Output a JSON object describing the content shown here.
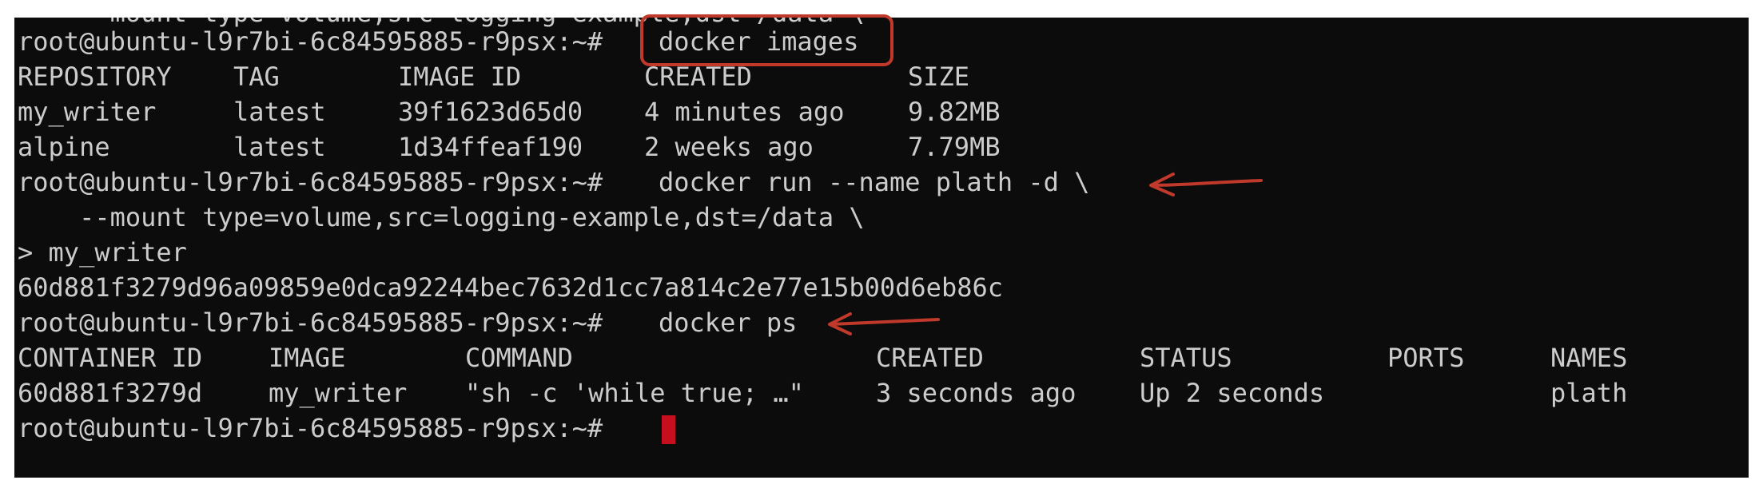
{
  "terminal": {
    "partial_top_line": "    --mount type=volume,src=logging-example,dst=/data \\",
    "prompt": "root@ubuntu-l9r7bi-6c84595885-r9psx:~#",
    "commands": {
      "images": "docker images",
      "run_line1": "docker run --name plath -d \\",
      "run_line2": "    --mount type=volume,src=logging-example,dst=/data \\",
      "run_line3": "> my_writer",
      "ps": "docker ps"
    },
    "images_table": {
      "headers": [
        "REPOSITORY",
        "TAG",
        "IMAGE ID",
        "CREATED",
        "SIZE"
      ],
      "rows": [
        [
          "my_writer",
          "latest",
          "39f1623d65d0",
          "4 minutes ago",
          "9.82MB"
        ],
        [
          "alpine",
          "latest",
          "1d34ffeaf190",
          "2 weeks ago",
          "7.79MB"
        ]
      ]
    },
    "container_hash": "60d881f3279d96a09859e0dca92244bec7632d1cc7a814c2e77e15b00d6eb86c",
    "ps_table": {
      "headers": [
        "CONTAINER ID",
        "IMAGE",
        "COMMAND",
        "CREATED",
        "STATUS",
        "PORTS",
        "NAMES"
      ],
      "rows": [
        [
          "60d881f3279d",
          "my_writer",
          "\"sh -c 'while true; …\"",
          "3 seconds ago",
          "Up 2 seconds",
          "",
          "plath"
        ]
      ]
    }
  },
  "colors": {
    "terminal_bg": "#0c0c0c",
    "terminal_text": "#cccccc",
    "cursor": "#c50f1f",
    "annotation": "#c0392b"
  },
  "annotations": [
    {
      "type": "box",
      "target": "docker images"
    },
    {
      "type": "arrow",
      "target": "docker run --name plath -d \\"
    },
    {
      "type": "arrow",
      "target": "docker ps"
    }
  ]
}
